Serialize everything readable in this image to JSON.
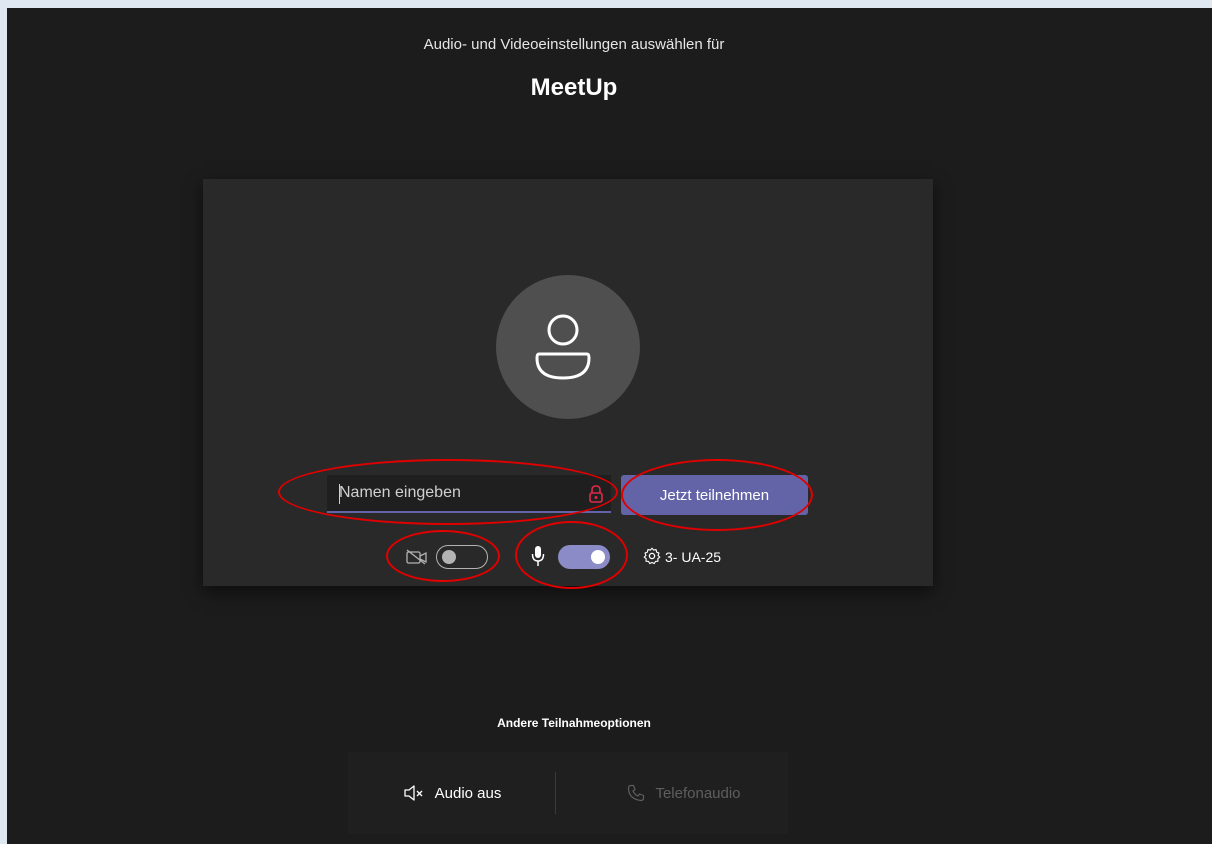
{
  "header": {
    "subtitle": "Audio- und Videoeinstellungen auswählen für",
    "title": "MeetUp"
  },
  "prejoin": {
    "avatar_icon": "person-icon",
    "name_input": {
      "placeholder": "Namen eingeben",
      "value": ""
    },
    "join_label": "Jetzt teilnehmen",
    "camera_enabled": false,
    "mic_enabled": true,
    "device_label": "3- UA-25"
  },
  "other_options": {
    "heading": "Andere Teilnahmeoptionen",
    "audio_off_label": "Audio aus",
    "phone_audio_label": "Telefonaudio"
  },
  "colors": {
    "accent": "#6264a7",
    "background": "#1c1c1c",
    "annotation": "#e00000"
  }
}
